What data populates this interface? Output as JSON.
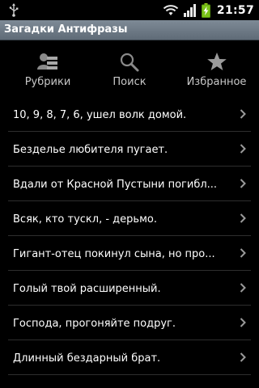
{
  "status_bar": {
    "time": "21:57",
    "icons": [
      "usb-icon",
      "wifi-icon",
      "signal-icon",
      "battery-charging-icon"
    ]
  },
  "app": {
    "title": "Загадки Антифразы"
  },
  "tabs": [
    {
      "label": "Рубрики",
      "icon": "categories-icon"
    },
    {
      "label": "Поиск",
      "icon": "search-icon"
    },
    {
      "label": "Избранное",
      "icon": "star-icon"
    }
  ],
  "riddles": [
    {
      "text": "10, 9, 8, 7, 6, ушел волк домой."
    },
    {
      "text": "Безделье любителя пугает."
    },
    {
      "text": "Вдали от Красной Пустыни погибл..."
    },
    {
      "text": "Всяк, кто тускл, - дерьмо."
    },
    {
      "text": "Гигант-отец покинул сына, но про..."
    },
    {
      "text": "Голый твой расширенный."
    },
    {
      "text": "Господа, прогоняйте подруг."
    },
    {
      "text": "Длинный бездарный брат."
    }
  ]
}
